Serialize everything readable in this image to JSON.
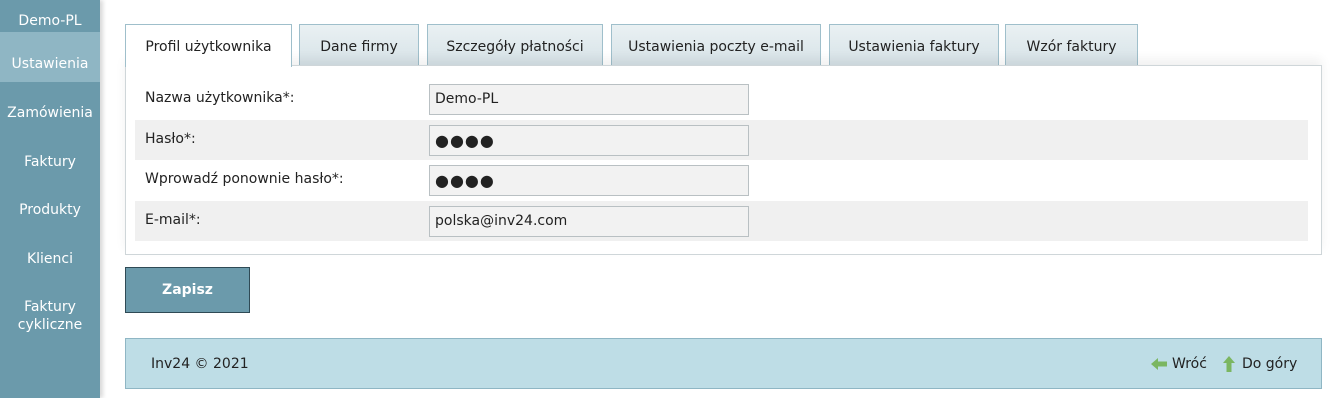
{
  "sidebar": {
    "user": "Demo-PL",
    "items": [
      {
        "label": "Ustawienia"
      },
      {
        "label": "Zamówienia"
      },
      {
        "label": "Faktury"
      },
      {
        "label": "Produkty"
      },
      {
        "label": "Klienci"
      },
      {
        "label": "Faktury cykliczne"
      }
    ]
  },
  "tabs": [
    {
      "label": "Profil użytkownika"
    },
    {
      "label": "Dane firmy"
    },
    {
      "label": "Szczegóły płatności"
    },
    {
      "label": "Ustawienia poczty e-mail"
    },
    {
      "label": "Ustawienia faktury"
    },
    {
      "label": "Wzór faktury"
    }
  ],
  "form": {
    "rows": [
      {
        "label": "Nazwa użytkownika*:",
        "value": "Demo-PL"
      },
      {
        "label": "Hasło*:",
        "value": "●●●●"
      },
      {
        "label": "Wprowadź ponownie hasło*:",
        "value": "●●●●"
      },
      {
        "label": "E-mail*:",
        "value": "polska@inv24.com"
      }
    ]
  },
  "actions": {
    "save_label": "Zapisz"
  },
  "footer": {
    "copyright": "Inv24 © 2021",
    "back_label": "Wróć",
    "top_label": "Do góry"
  },
  "colors": {
    "sidebar": "#6b9aab",
    "sidebar_active": "#8fb6c4",
    "footer": "#bedde6",
    "arrow_green": "#7bb661"
  }
}
